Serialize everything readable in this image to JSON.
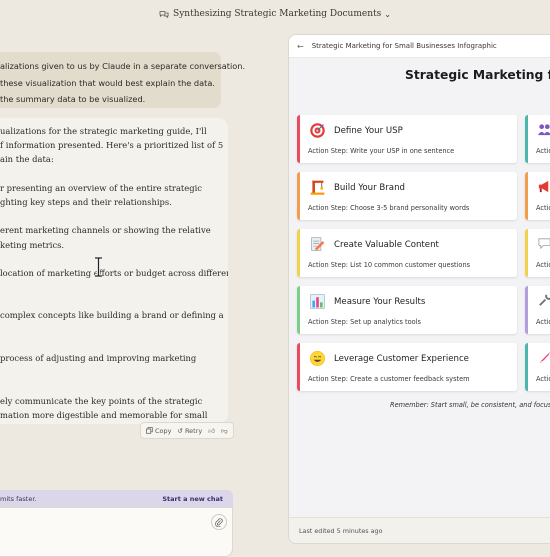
{
  "header": {
    "title": "Synthesizing Strategic Marketing Documents"
  },
  "user_message": {
    "lines": [
      "alizations given to us by Claude in a separate conversation.",
      "these visualization that would best explain the data.",
      "the summary data to be visualized."
    ]
  },
  "assistant_message": {
    "lines": [
      "ualizations for the strategic marketing guide, I'll",
      "f information presented. Here's a prioritized list of 5",
      "ain the data:",
      "",
      "r presenting an overview of the entire strategic",
      "ghting key steps and their relationships.",
      "",
      "erent marketing channels or showing the relative",
      "keting metrics.",
      "",
      "location of marketing efforts or budget across different",
      "",
      "",
      " complex concepts like building a brand or defining a",
      "",
      "",
      "process of adjusting and improving marketing",
      "",
      "",
      "ely communicate the key points of the strategic",
      "mation more digestible and memorable for small"
    ],
    "actions": {
      "copy": "Copy",
      "retry": "Retry"
    }
  },
  "banner": {
    "text": "mits faster.",
    "link": "Start a new chat"
  },
  "artifact": {
    "header_title": "Strategic Marketing for Small Businesses Infographic",
    "title": "Strategic Marketing for S",
    "cards": [
      {
        "title": "Define Your USP",
        "step": "Action Step: Write your USP in one sentence",
        "color": "#e84a5f",
        "icon": "target-icon"
      },
      {
        "title": "Build Your Brand",
        "step": "Action Step: Choose 3-5 brand personality words",
        "color": "#f29e4c",
        "icon": "construction-icon"
      },
      {
        "title": "Create Valuable Content",
        "step": "Action Step: List 10 common customer questions",
        "color": "#f2d14c",
        "icon": "writing-icon"
      },
      {
        "title": "Measure Your Results",
        "step": "Action Step: Set up analytics tools",
        "color": "#7ccf8a",
        "icon": "chart-icon"
      },
      {
        "title": "Leverage Customer Experience",
        "step": "Action Step: Create a customer feedback system",
        "color": "#e84a5f",
        "icon": "smile-icon"
      }
    ],
    "side_cards": [
      {
        "step": "Actio",
        "color": "#4db6ac",
        "icon": "people-icon"
      },
      {
        "step": "Actio",
        "color": "#f29e4c",
        "icon": "megaphone-icon"
      },
      {
        "step": "Actio",
        "color": "#f2d14c",
        "icon": "speech-bubble-icon"
      },
      {
        "step": "Actio",
        "color": "#b39ddb",
        "icon": "wrench-icon"
      },
      {
        "step": "Actio",
        "color": "#4db6ac",
        "icon": "rocket-icon"
      }
    ],
    "reminder": "Remember: Start small, be consistent, and focus on p",
    "footer": "Last edited 5 minutes ago"
  }
}
